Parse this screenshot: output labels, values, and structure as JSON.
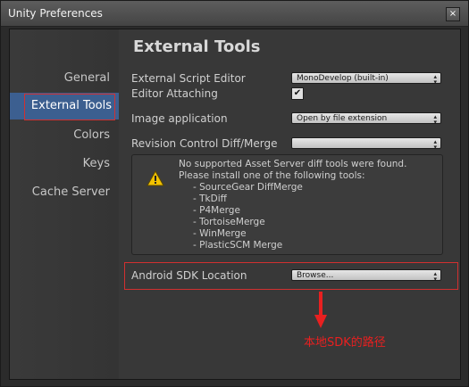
{
  "window": {
    "title": "Unity Preferences",
    "close_glyph": "×"
  },
  "sidebar": {
    "items": [
      {
        "label": "General"
      },
      {
        "label": "External Tools",
        "active": true
      },
      {
        "label": "Colors"
      },
      {
        "label": "Keys"
      },
      {
        "label": "Cache Server"
      }
    ]
  },
  "main": {
    "heading": "External Tools",
    "rows": {
      "script_editor": {
        "label": "External Script Editor",
        "value": "MonoDevelop (built-in)"
      },
      "editor_attaching": {
        "label": "Editor Attaching",
        "checked": true,
        "check_glyph": "✔"
      },
      "image_app": {
        "label": "Image application",
        "value": "Open by file extension"
      },
      "revision_control": {
        "label": "Revision Control Diff/Merge",
        "value": ""
      },
      "android_sdk": {
        "label": "Android SDK Location",
        "value": "Browse..."
      }
    },
    "help": {
      "icon": "warning-icon",
      "lines": [
        "No supported Asset Server diff tools were found.",
        "Please install one of the following tools:",
        "- SourceGear DiffMerge",
        "- TkDiff",
        "- P4Merge",
        "- TortoiseMerge",
        "- WinMerge",
        "- PlasticSCM Merge"
      ]
    }
  },
  "annotation": {
    "text": "本地SDK的路径",
    "color": "#e82020"
  },
  "colors": {
    "selection": "#3c5f90",
    "annotation_red": "#d23030"
  }
}
